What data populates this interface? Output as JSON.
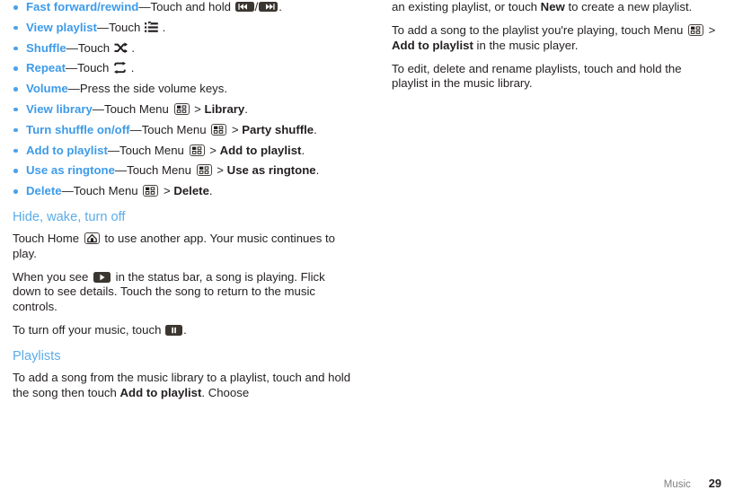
{
  "document": {
    "footer": {
      "chapter_label": "Music",
      "page_number": "29"
    },
    "colors": {
      "heading_blue": "#5bace9",
      "term_blue": "#3d9be9",
      "bullet_blue": "#4da2e8",
      "body_text": "#231f20",
      "icon_dark": "#3b362f",
      "footer_gray": "#7f7f7f"
    }
  },
  "left_column": {
    "bullets": [
      {
        "term": "Fast forward/rewind",
        "dash": "—",
        "text_before_icon": "Touch and hold ",
        "icon_1": "rewind-icon",
        "separator": "/",
        "icon_2": "fast-forward-icon",
        "text_after": "."
      },
      {
        "term": "View playlist",
        "dash": "—",
        "text_before_icon": "Touch ",
        "icon_1": "view-playlist-icon",
        "text_after": " ."
      },
      {
        "term": "Shuffle",
        "dash": "—",
        "text_before_icon": "Touch ",
        "icon_1": "shuffle-icon",
        "text_after": " ."
      },
      {
        "term": "Repeat",
        "dash": "—",
        "text_before_icon": "Touch ",
        "icon_1": "repeat-icon",
        "text_after": " ."
      },
      {
        "term": "Volume",
        "dash": "—",
        "text_before_icon": "Press the side volume keys.",
        "icon_1": null,
        "text_after": ""
      },
      {
        "term": "View library",
        "dash": "—",
        "text_before_icon": "Touch Menu ",
        "icon_1": "menu-icon",
        "text_mid": " > ",
        "bold_target": "Library",
        "text_after": "."
      },
      {
        "term": "Turn shuffle on/off",
        "dash": "—",
        "text_before_icon": "Touch Menu ",
        "icon_1": "menu-icon",
        "text_mid": " > ",
        "bold_target": "Party shuffle",
        "text_after": "."
      },
      {
        "term": "Add to playlist",
        "dash": "—",
        "text_before_icon": "Touch Menu ",
        "icon_1": "menu-icon",
        "text_mid": " > ",
        "bold_target": "Add to playlist",
        "text_after": "."
      },
      {
        "term": "Use as ringtone",
        "dash": "—",
        "text_before_icon": "Touch Menu ",
        "icon_1": "menu-icon",
        "text_mid": " > ",
        "bold_target": "Use as ringtone",
        "text_after": "."
      },
      {
        "term": "Delete",
        "dash": "—",
        "text_before_icon": "Touch Menu ",
        "icon_1": "menu-icon",
        "text_mid": " > ",
        "bold_target": "Delete",
        "text_after": "."
      }
    ],
    "section_hide_wake": {
      "heading": "Hide, wake, turn off",
      "para_1_before": "Touch Home ",
      "para_1_icon": "home-icon",
      "para_1_after": " to use another app. Your music continues to play.",
      "para_2_before": "When you see ",
      "para_2_icon": "play-status-icon",
      "para_2_after": " in the status bar, a song is playing. Flick down to see details. Touch the song to return to the music controls.",
      "para_3_before": "To turn off your music, touch ",
      "para_3_icon": "pause-icon",
      "para_3_after": "."
    },
    "section_playlists": {
      "heading": "Playlists",
      "para_1_before": "To add a song from the music library to a playlist, touch and hold the song then touch ",
      "para_1_bold": "Add to playlist",
      "para_1_after": ". Choose"
    }
  },
  "right_column": {
    "continuation": {
      "before_bold": "an existing playlist, or touch ",
      "bold": "New",
      "after_bold": " to create a new playlist."
    },
    "para_add_song": {
      "before_icon": "To add a song to the playlist you're playing, touch Menu ",
      "icon": "menu-icon",
      "text_mid": " > ",
      "bold": "Add to playlist",
      "after_bold": " in the music player."
    },
    "para_edit": "To edit, delete and rename playlists, touch and hold the playlist in the music library."
  }
}
